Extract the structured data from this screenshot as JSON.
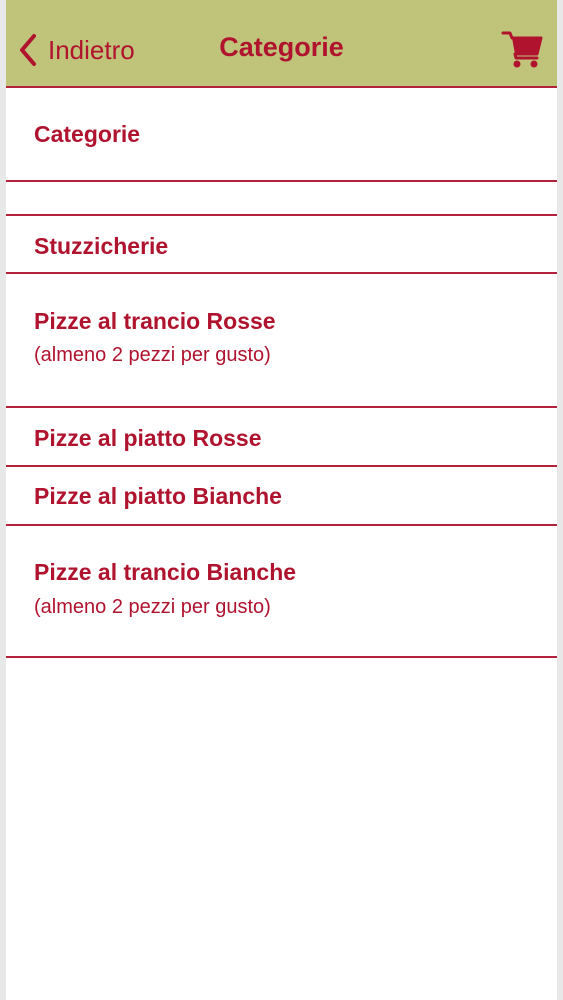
{
  "navbar": {
    "back_label": "Indietro",
    "title": "Categorie",
    "cart_icon": "shopping-cart-icon",
    "accent_color": "#b0132e",
    "bar_color": "#c0c37a"
  },
  "section": {
    "header": "Categorie"
  },
  "categories": [
    {
      "label": "Stuzzicherie",
      "sub": ""
    },
    {
      "label": "Pizze al trancio Rosse",
      "sub": "(almeno 2 pezzi per gusto)"
    },
    {
      "label": "Pizze al piatto Rosse",
      "sub": ""
    },
    {
      "label": "Pizze al piatto Bianche",
      "sub": ""
    },
    {
      "label": "Pizze al trancio Bianche",
      "sub": "(almeno 2 pezzi per gusto)"
    }
  ]
}
